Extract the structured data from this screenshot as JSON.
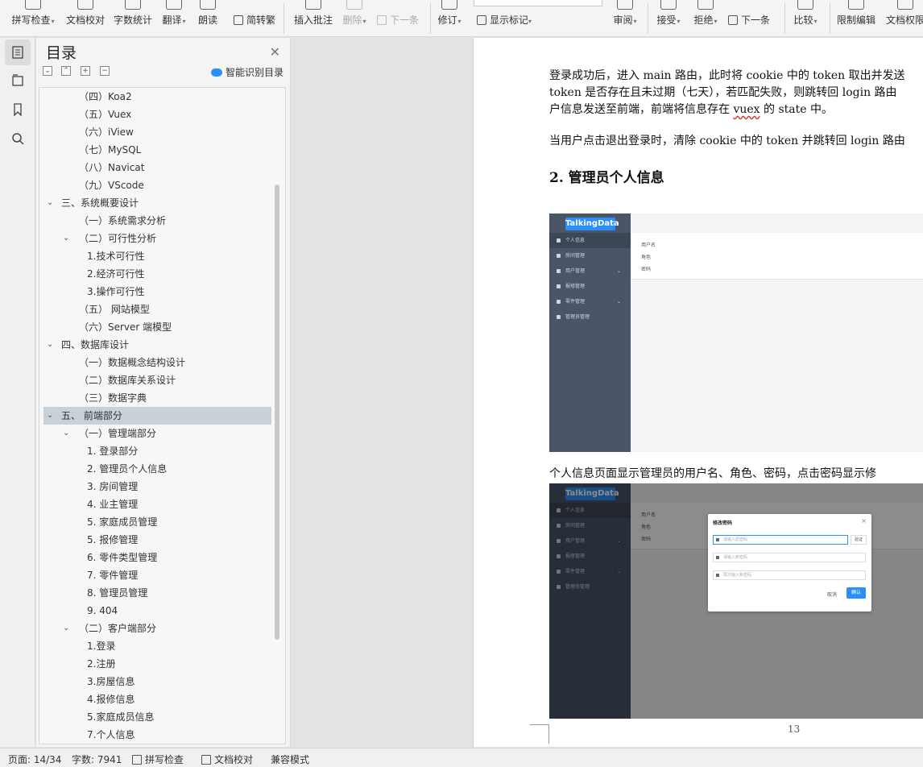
{
  "ribbon": {
    "buttons": [
      {
        "id": "spell",
        "label": "拼写检查",
        "caret": true
      },
      {
        "id": "proof",
        "label": "文档校对",
        "caret": false
      },
      {
        "id": "wordcount",
        "label": "字数统计",
        "caret": false
      },
      {
        "id": "translate",
        "label": "翻译",
        "caret": true
      },
      {
        "id": "read",
        "label": "朗读",
        "caret": false
      },
      {
        "id": "insert_comment",
        "label": "插入批注",
        "caret": false
      },
      {
        "id": "delete",
        "label": "删除",
        "caret": true
      },
      {
        "id": "revise",
        "label": "修订",
        "caret": true
      },
      {
        "id": "review",
        "label": "审阅",
        "caret": true
      },
      {
        "id": "accept",
        "label": "接受",
        "caret": true
      },
      {
        "id": "reject",
        "label": "拒绝",
        "caret": true
      },
      {
        "id": "compare",
        "label": "比较",
        "caret": true
      },
      {
        "id": "restrict",
        "label": "限制编辑",
        "caret": false
      },
      {
        "id": "docperm",
        "label": "文档权限",
        "caret": false
      }
    ],
    "convert_label": "简转繁",
    "next_comment_label": "下一条",
    "show_marks_label": "显示标记",
    "next_change_label": "下一条",
    "caret": "▾"
  },
  "rail": {
    "icons": [
      "toc-icon",
      "chapter-nav-icon",
      "bookmark-icon",
      "search-icon"
    ]
  },
  "toc": {
    "title": "目录",
    "smart_label": "智能识别目录",
    "items": [
      {
        "text": "（四）Koa2",
        "level": 2,
        "chev": ""
      },
      {
        "text": "（五）Vuex",
        "level": 2,
        "chev": ""
      },
      {
        "text": "（六）iView",
        "level": 2,
        "chev": ""
      },
      {
        "text": "（七）MySQL",
        "level": 2,
        "chev": ""
      },
      {
        "text": "（八）Navicat",
        "level": 2,
        "chev": ""
      },
      {
        "text": "（九）VScode",
        "level": 2,
        "chev": ""
      },
      {
        "text": "三、系统概要设计",
        "level": 1,
        "chev": "v"
      },
      {
        "text": "（一）系统需求分析",
        "level": 2,
        "chev": ""
      },
      {
        "text": "（二）可行性分析",
        "level": 2,
        "chev": "v"
      },
      {
        "text": "1.技术可行性",
        "level": 3,
        "chev": ""
      },
      {
        "text": "2.经济可行性",
        "level": 3,
        "chev": ""
      },
      {
        "text": "3.操作可行性",
        "level": 3,
        "chev": ""
      },
      {
        "text": "（五）  网站模型",
        "level": 2,
        "chev": ""
      },
      {
        "text": "（六）Server 端模型",
        "level": 2,
        "chev": ""
      },
      {
        "text": "四、数据库设计",
        "level": 1,
        "chev": "v"
      },
      {
        "text": "（一）数据概念结构设计",
        "level": 2,
        "chev": ""
      },
      {
        "text": "（二）数据库关系设计",
        "level": 2,
        "chev": ""
      },
      {
        "text": "（三）数据字典",
        "level": 2,
        "chev": ""
      },
      {
        "text": "五、  前端部分",
        "level": 1,
        "chev": "v",
        "selected": true
      },
      {
        "text": "（一）管理端部分",
        "level": 2,
        "chev": "v"
      },
      {
        "text": "1. 登录部分",
        "level": 3,
        "chev": ""
      },
      {
        "text": "2. 管理员个人信息",
        "level": 3,
        "chev": ""
      },
      {
        "text": "3. 房间管理",
        "level": 3,
        "chev": ""
      },
      {
        "text": "4. 业主管理",
        "level": 3,
        "chev": ""
      },
      {
        "text": "5. 家庭成员管理",
        "level": 3,
        "chev": ""
      },
      {
        "text": "5. 报修管理",
        "level": 3,
        "chev": ""
      },
      {
        "text": "6. 零件类型管理",
        "level": 3,
        "chev": ""
      },
      {
        "text": "7. 零件管理",
        "level": 3,
        "chev": ""
      },
      {
        "text": "8. 管理员管理",
        "level": 3,
        "chev": ""
      },
      {
        "text": "9. 404",
        "level": 3,
        "chev": ""
      },
      {
        "text": "（二）客户端部分",
        "level": 2,
        "chev": "v"
      },
      {
        "text": "1.登录",
        "level": 3,
        "chev": ""
      },
      {
        "text": "2.注册",
        "level": 3,
        "chev": ""
      },
      {
        "text": "3.房屋信息",
        "level": 3,
        "chev": ""
      },
      {
        "text": "4.报修信息",
        "level": 3,
        "chev": ""
      },
      {
        "text": "5.家庭成员信息",
        "level": 3,
        "chev": ""
      },
      {
        "text": "7.个人信息",
        "level": 3,
        "chev": ""
      }
    ]
  },
  "document": {
    "para1_line1": "登录成功后，进入 main 路由，此时将 cookie 中的 token 取出并发送",
    "para1_line2": "token 是否存在且未过期（七天），若匹配失败，则跳转回 login 路由",
    "para1_line3_a": "户信息发送至前端，前端将信息存在 ",
    "para1_line3_vuex": "vuex",
    "para1_line3_b": " 的 state 中。",
    "para2": "当用户点击退出登录时，清除 cookie 中的 token 并跳转回 login 路由",
    "heading": "2.  管理员个人信息",
    "para3": "个人信息页面显示管理员的用户名、角色、密码，点击密码显示修",
    "page_number": "13",
    "shot": {
      "logo": "TalkingData",
      "menu": [
        "个人信息",
        "房间管理",
        "用户管理",
        "报修管理",
        "零件管理",
        "管理员管理"
      ],
      "fields": [
        "用户名",
        "角色",
        "密码"
      ],
      "dialog_title": "修改密码",
      "dialog_fields": [
        "请输入原密码",
        "请输入新密码",
        "再次输入新密码"
      ],
      "verify": "验证",
      "cancel": "取消",
      "ok": "确认"
    }
  },
  "status": {
    "page": "页面: 14/34",
    "words": "字数: 7941",
    "spell": "拼写检查",
    "proof": "文档校对",
    "compat": "兼容模式"
  }
}
